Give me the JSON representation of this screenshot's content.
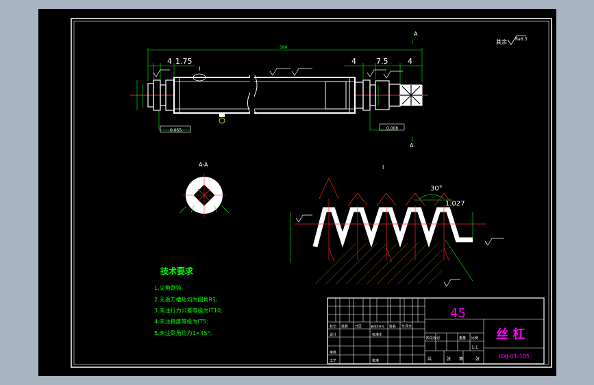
{
  "colors": {
    "bg": "#a9b4c2",
    "paper": "#000000",
    "line": "#ffffff",
    "dim": "#00ff00",
    "center": "#ff2020",
    "mag": "#ff00ff",
    "yel": "#ffff00",
    "cyan": "#00ffff"
  },
  "roughness": "其余",
  "roughness_val": "Ra6.3",
  "dims": {
    "length": "380",
    "d1": "4",
    "d2": "1.75",
    "d3": "4",
    "d4": "7.5",
    "d5": "4"
  },
  "section_label_1": "A",
  "section_label_2": "A",
  "detail_mark": "I",
  "section_title": "A-A",
  "detail_title": "I",
  "angle": "30°",
  "pitch": "1.027",
  "tol1": "0.055",
  "tol2": "0.006",
  "tech": {
    "title": "技术要求",
    "items": [
      "1.尖角倒钝.",
      "2.无退刀槽处均为圆角R1;",
      "3.未注行为公差等级为IT10;",
      "4.未注精度等级为IT5;",
      "5.未注倒角均为1×45°;"
    ]
  },
  "titleblock": {
    "material": "45",
    "part_name": "丝 杠",
    "drawing_no": "GXJ-01-105",
    "scale": "1:1",
    "row_labels": [
      "标记",
      "处数",
      "分区",
      "更改文件号",
      "签名",
      "年月日"
    ],
    "left_labels": [
      "设计",
      "审核",
      "工艺",
      "标准化",
      "批准"
    ],
    "mid_labels": [
      "阶段标记",
      "重量",
      "比例"
    ],
    "bottom": [
      "共",
      "张",
      "第",
      "张"
    ]
  }
}
